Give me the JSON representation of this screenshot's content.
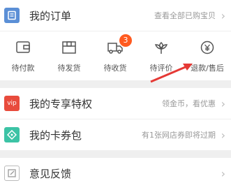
{
  "orders": {
    "title": "我的订单",
    "subtitle": "查看全部已购宝贝",
    "tabs": [
      {
        "label": "待付款",
        "icon": "wallet-icon"
      },
      {
        "label": "待发货",
        "icon": "package-icon"
      },
      {
        "label": "待收货",
        "icon": "truck-icon",
        "badge": "3"
      },
      {
        "label": "待评价",
        "icon": "flower-icon"
      },
      {
        "label": "退款/售后",
        "icon": "refund-icon"
      }
    ]
  },
  "vip": {
    "icon_text": "vip",
    "title": "我的专享特权",
    "subtitle": "领金币，看优惠"
  },
  "coupons": {
    "title": "我的卡券包",
    "subtitle": "有1张网店券即将过期"
  },
  "feedback": {
    "title": "意见反馈"
  },
  "colors": {
    "accent_red": "#e84b3c",
    "coupon_teal": "#3cc3a5",
    "order_blue": "#4a90e2",
    "badge_orange": "#ff5a1f",
    "arrow_red": "#e53935"
  }
}
